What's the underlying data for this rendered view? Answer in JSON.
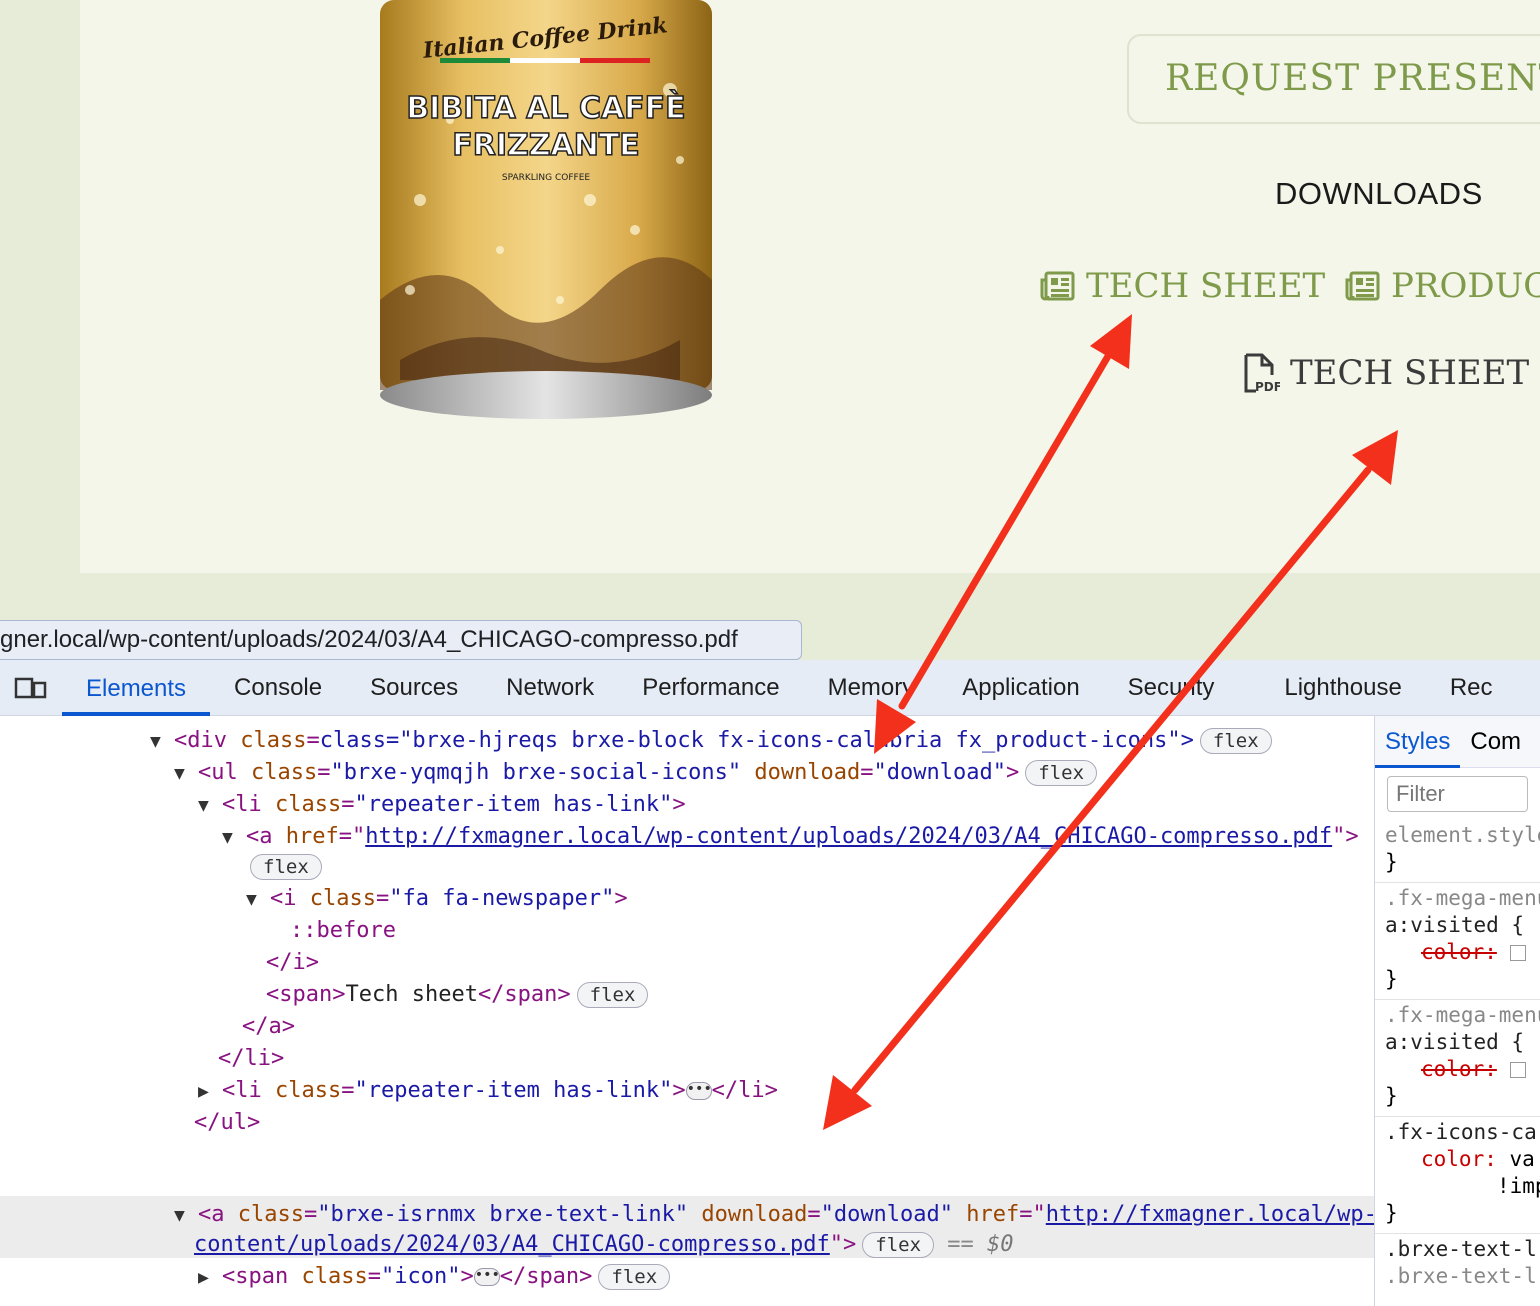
{
  "page": {
    "can": {
      "brand_text": "Italian Coffee Drink",
      "line1": "BIBITA AL CAFFÈ",
      "line2": "FRIZZANTE",
      "tag": "SPARKLING COFFEE"
    },
    "request_button": "REQUEST PRESENTATIO",
    "downloads_heading": "DOWNLOADS",
    "links": {
      "tech_sheet_1": "TECH SHEET",
      "product": "PRODUCT",
      "tech_sheet_2": "TECH SHEET"
    },
    "pdf_icon_label": "PDF",
    "url_tooltip": "gner.local/wp-content/uploads/2024/03/A4_CHICAGO-compresso.pdf",
    "colors": {
      "green": "#7e9a4a",
      "card_bg": "#f3f6e8",
      "page_bg": "#e6ecd8",
      "arrow": "#f2301b"
    }
  },
  "devtools": {
    "tabs": [
      "Elements",
      "Console",
      "Sources",
      "Network",
      "Performance",
      "Memory",
      "Application",
      "Security",
      "Lighthouse",
      "Rec"
    ],
    "active_tab": "Elements",
    "dom": {
      "l0": "class=\"brxe-hjreqs brxe-block fx-icons-calabria",
      "l0b": "fx_product-icons\">",
      "l1_cls": "\"brxe-yqmqjh brxe-social-icons\"",
      "l1_dl": "\"download\"",
      "l2_cls": "\"repeater-item has-link\"",
      "l3_href": "http://fxmagner.local/wp-content/uploads/2024/03/A4_CHICAGO-compresso.pdf",
      "l5_cls": "\"fa fa-newspaper\"",
      "pseudo": "::before",
      "span_text": "Tech sheet",
      "li2_cls": "\"repeater-item has-link\"",
      "sel_cls": "\"brxe-isrnmx brxe-text-link\"",
      "sel_dl": "\"download\"",
      "sel_href1": "http://fxmagner.local/wp-",
      "sel_href2": "content/uploads/2024/03/A4_CHICAGO-compresso.pdf",
      "dollar": "$0",
      "icon_cls": "\"icon\"",
      "text_cls": "\"text\"",
      "text_val": "tech sheet",
      "flex": "flex",
      "eq": "=="
    },
    "styles": {
      "tabs": [
        "Styles",
        "Com"
      ],
      "filter_placeholder": "Filter",
      "r1": "element.style {",
      "r2_sel": ".fx-mega-menu",
      "r2_b": "a:visited {",
      "prop_color": "color:",
      "r4_sel": ".fx-icons-ca",
      "r4_val": "va",
      "r4_imp": "!imp",
      "r5": ".brxe-text-l",
      "r5b": ".brxe-text-l"
    }
  }
}
